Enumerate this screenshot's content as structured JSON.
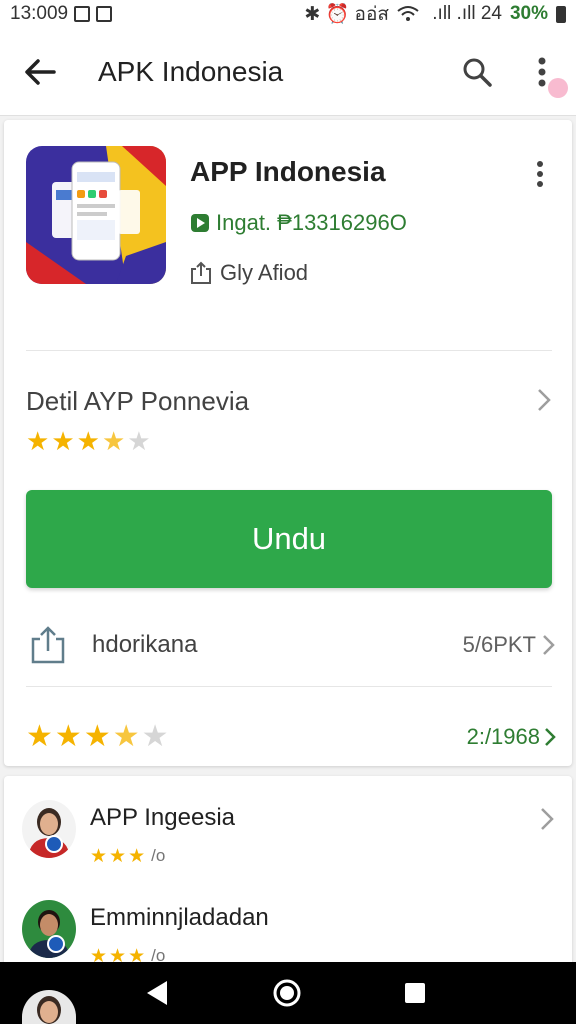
{
  "status_bar": {
    "time": "13:009",
    "right_text": "✱ ⏰ ออ่ส",
    "signal": " .ıll .ıll 24",
    "battery_pct": "30%"
  },
  "app_bar": {
    "title": "APK Indonesia",
    "back_icon": "back-arrow-icon",
    "search_icon": "search-icon",
    "more_icon": "more-vert-icon"
  },
  "app": {
    "name": "APP Indonesia",
    "install_text": "Ingat. ₱13316296O",
    "share_text": "Gly Afiod",
    "detail_title": "Detil AYP Ponnevia",
    "detail_rating": 3.5,
    "download_label": "Undu",
    "share_label": "hdorikana",
    "share_value": "5/6PKT",
    "rating": 3.5,
    "rating_count": "2:/1968"
  },
  "reviews": [
    {
      "name": "APP Ingeesia",
      "rating": 3,
      "score": "/o"
    },
    {
      "name": "Emminnjladadan",
      "rating": 3,
      "score": "/o"
    }
  ],
  "colors": {
    "accent": "#2ea84a",
    "link": "#2e7d32",
    "star": "#f5b300"
  }
}
